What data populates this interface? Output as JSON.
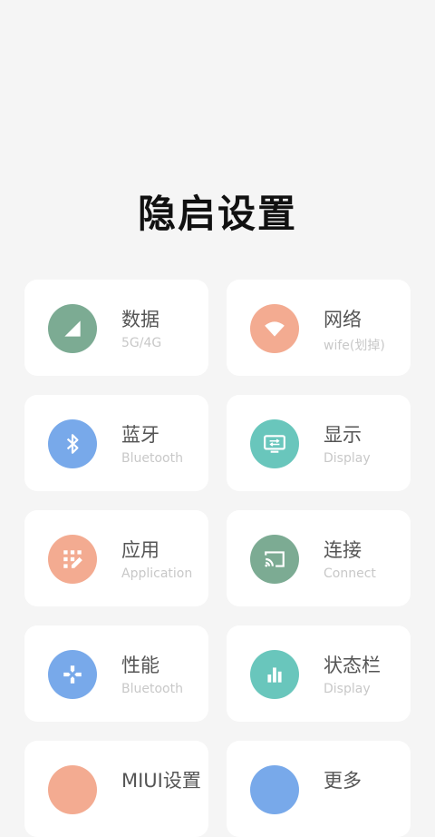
{
  "page": {
    "title": "隐启设置"
  },
  "colors": {
    "green": "#7cab93",
    "salmon": "#f3ab91",
    "blue": "#78a9ea",
    "teal": "#69c6bc"
  },
  "cards": [
    {
      "label": "数据",
      "sub": "5G/4G",
      "icon": "signal-icon"
    },
    {
      "label": "网络",
      "sub": "wife(划掉)",
      "icon": "wifi-icon"
    },
    {
      "label": "蓝牙",
      "sub": "Bluetooth",
      "icon": "bluetooth-icon"
    },
    {
      "label": "显示",
      "sub": "Display",
      "icon": "display-icon"
    },
    {
      "label": "应用",
      "sub": "Application",
      "icon": "apps-icon"
    },
    {
      "label": "连接",
      "sub": "Connect",
      "icon": "cast-icon"
    },
    {
      "label": "性能",
      "sub": "Bluetooth",
      "icon": "gamepad-icon"
    },
    {
      "label": "状态栏",
      "sub": "Display",
      "icon": "bar-chart-icon"
    },
    {
      "label": "MIUI设置",
      "sub": "",
      "icon": "miui-icon"
    },
    {
      "label": "更多",
      "sub": "",
      "icon": "more-icon"
    }
  ]
}
